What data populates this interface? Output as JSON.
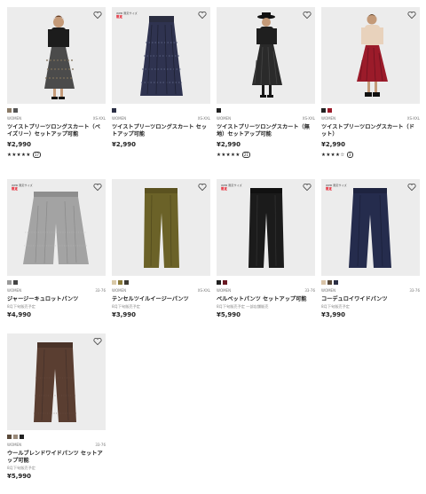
{
  "badge": {
    "line1": "WEB 限定サイズ",
    "line2": "限定"
  },
  "products": [
    {
      "gender": "WOMEN",
      "size": "XS-XXL",
      "name": "ツイストプリーツロングスカート（ペイズリー）セットアップ可能",
      "note": "",
      "price": "¥2,990",
      "stars": "★★★★★",
      "reviews": "17",
      "swatches": [
        "#8a7a66",
        "#555555"
      ],
      "badge": false
    },
    {
      "gender": "WOMEN",
      "size": "XS-XXL",
      "name": "ツイストプリーツロングスカート セットアップ可能",
      "note": "",
      "price": "¥2,990",
      "stars": "",
      "reviews": "",
      "swatches": [
        "#2b2f45"
      ],
      "badge": true
    },
    {
      "gender": "WOMEN",
      "size": "XS-XXL",
      "name": "ツイストプリーツロングスカート（無地）セットアップ可能",
      "note": "",
      "price": "¥2,990",
      "stars": "★★★★★",
      "reviews": "21",
      "swatches": [
        "#222222"
      ],
      "badge": false
    },
    {
      "gender": "WOMEN",
      "size": "XS-XXL",
      "name": "ツイストプリーツロングスカート（ドット）",
      "note": "",
      "price": "¥2,990",
      "stars": "★★★★☆",
      "reviews": "3",
      "swatches": [
        "#222222",
        "#9b1b2a"
      ],
      "badge": false
    },
    {
      "gender": "WOMEN",
      "size": "33-76",
      "name": "ジャージーキュロットパンツ",
      "note": "8月下旬販売予定",
      "price": "¥4,990",
      "stars": "",
      "reviews": "",
      "swatches": [
        "#9a9a9a",
        "#444444"
      ],
      "badge": true
    },
    {
      "gender": "WOMEN",
      "size": "XS-XXL",
      "name": "テンセルツイルイージーパンツ",
      "note": "8月下旬販売予定",
      "price": "¥3,990",
      "stars": "",
      "reviews": "",
      "swatches": [
        "#d9c9a8",
        "#8a7a3a",
        "#3d3a33"
      ],
      "badge": false
    },
    {
      "gender": "WOMEN",
      "size": "33-76",
      "name": "ベルベットパンツ セットアップ可能",
      "note": "8月下旬販売予定 一部店舗販売",
      "price": "¥5,990",
      "stars": "",
      "reviews": "",
      "swatches": [
        "#222222",
        "#6a1a24"
      ],
      "badge": true
    },
    {
      "gender": "WOMEN",
      "size": "33-76",
      "name": "コーデュロイワイドパンツ",
      "note": "8月下旬販売予定",
      "price": "¥3,990",
      "stars": "",
      "reviews": "",
      "swatches": [
        "#d9c4a8",
        "#5a4a3a",
        "#2b2f45"
      ],
      "badge": true
    },
    {
      "gender": "WOMEN",
      "size": "33-76",
      "name": "ウールブレンドワイドパンツ セットアップ可能",
      "note": "8月下旬販売予定",
      "price": "¥5,990",
      "stars": "",
      "reviews": "",
      "swatches": [
        "#5a4a3a",
        "#9a8a7a",
        "#222222"
      ],
      "badge": false
    }
  ]
}
